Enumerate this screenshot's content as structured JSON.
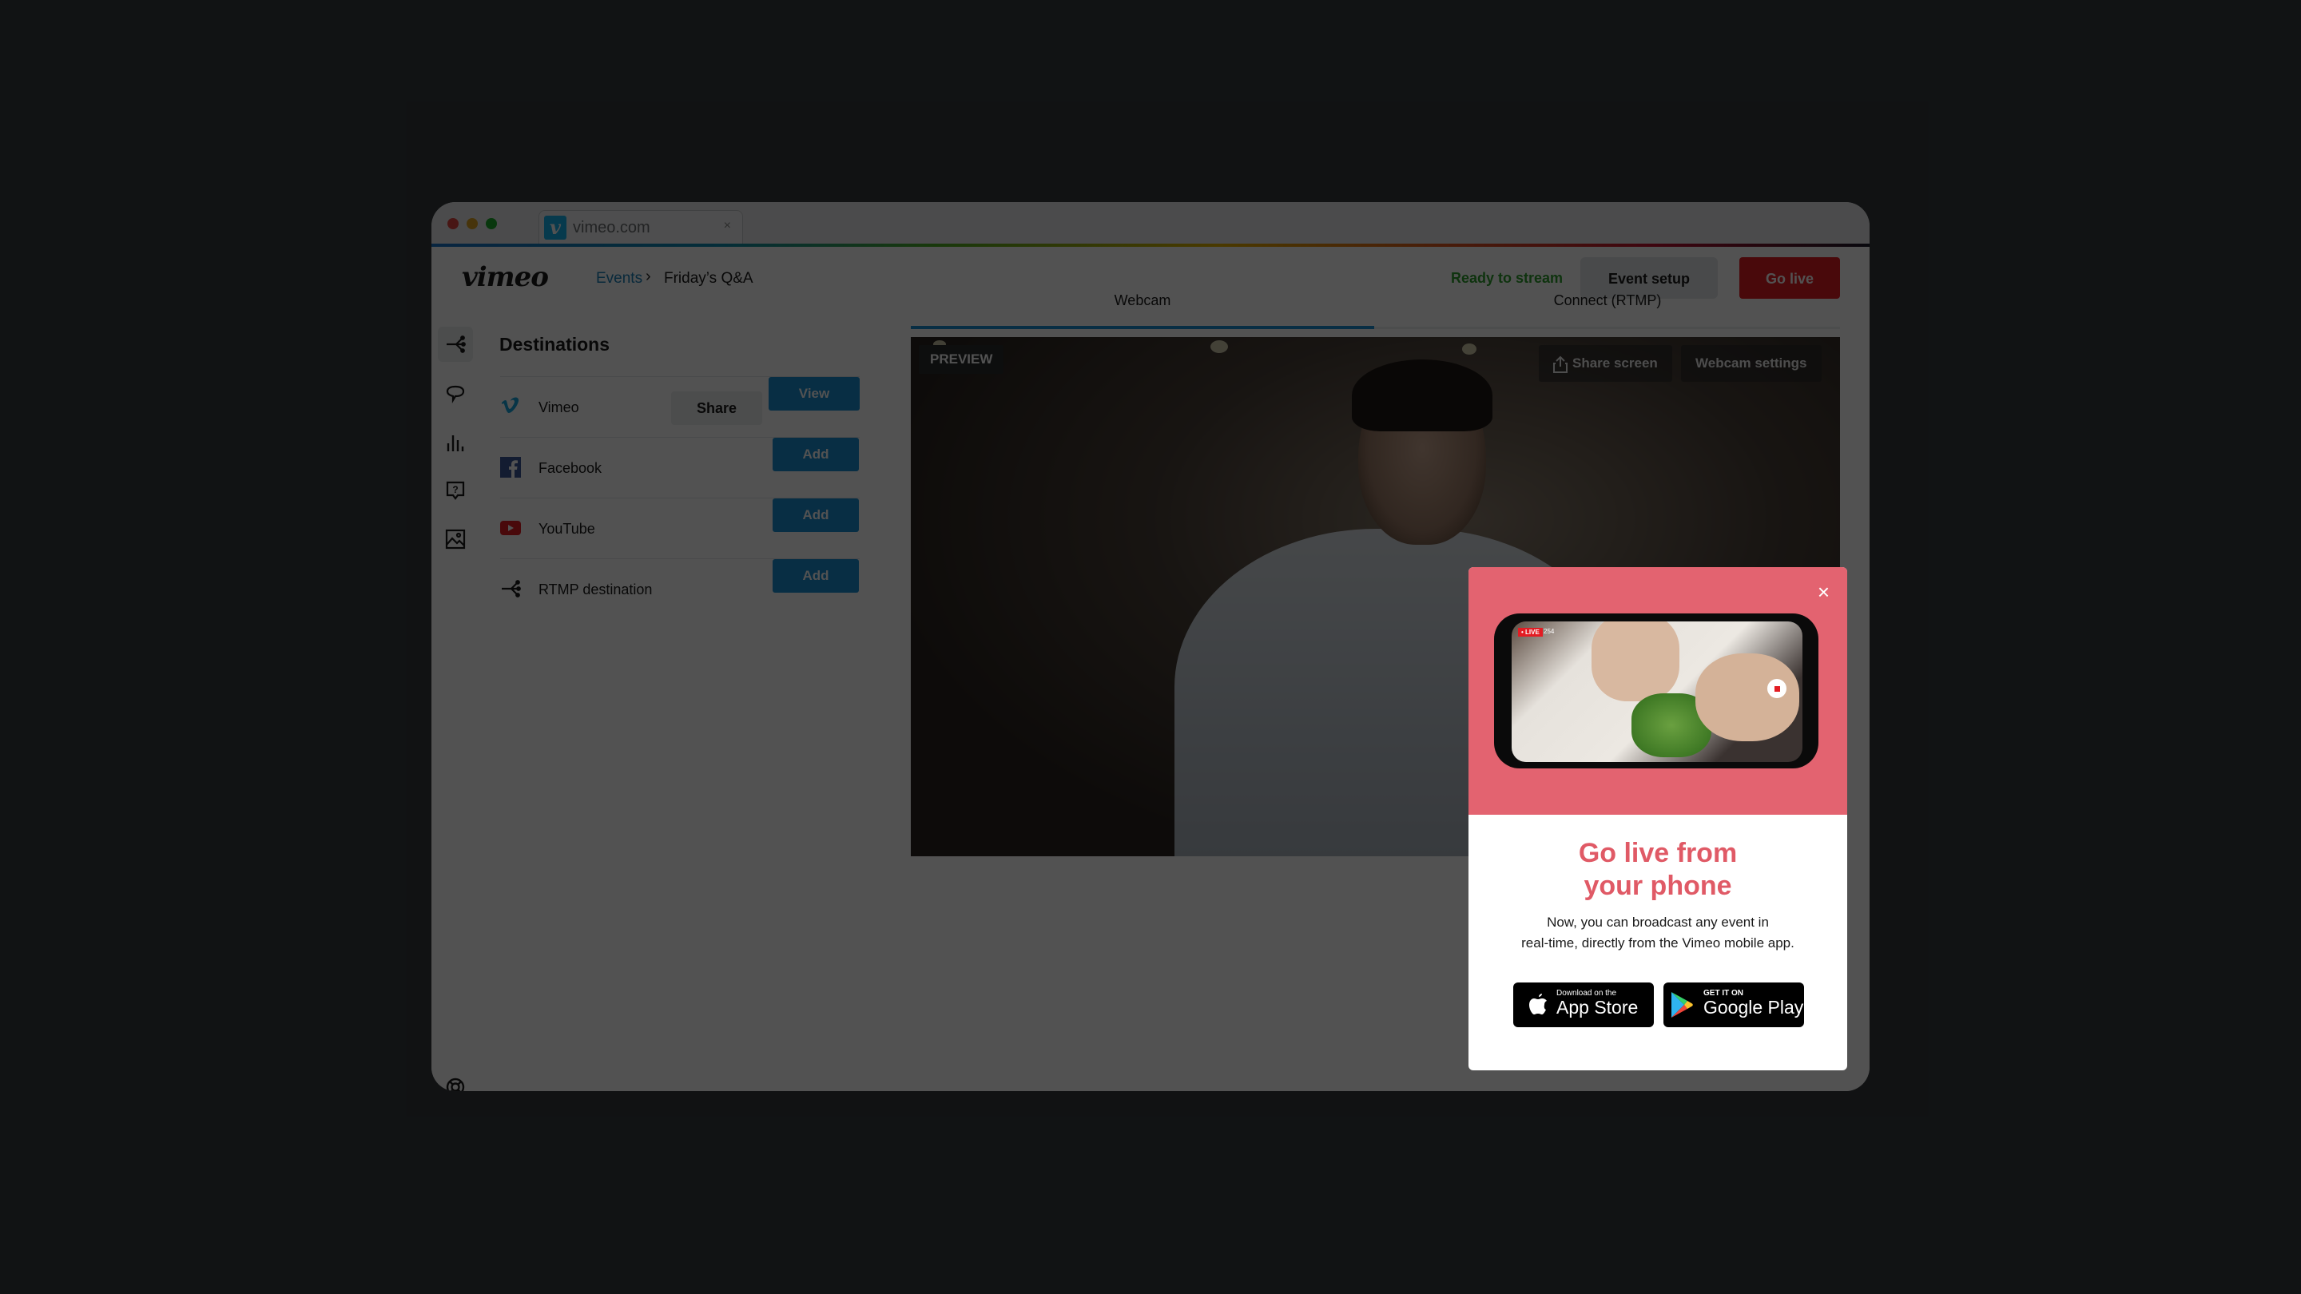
{
  "browser": {
    "tab_title": "vimeo.com",
    "tab_close": "×",
    "favicon": "v",
    "traffic_lights": [
      "#e0443e",
      "#dea123",
      "#1aab29"
    ]
  },
  "header": {
    "logo": "vimeo",
    "breadcrumb": {
      "parent": "Events",
      "separator": "›",
      "current": "Friday’s Q&A"
    },
    "status": "Ready to stream",
    "event_setup_label": "Event setup",
    "go_live_label": "Go live"
  },
  "sidebar": {
    "items": [
      {
        "icon": "destinations-icon",
        "active": true
      },
      {
        "icon": "chat-icon"
      },
      {
        "icon": "analytics-icon"
      },
      {
        "icon": "qa-icon"
      },
      {
        "icon": "graphics-icon"
      }
    ],
    "footer_icon": "help-icon"
  },
  "destinations": {
    "title": "Destinations",
    "items": [
      {
        "name": "Vimeo",
        "icon": "vimeo-icon",
        "secondary_label": "Share",
        "primary_label": "View"
      },
      {
        "name": "Facebook",
        "icon": "facebook-icon",
        "primary_label": "Add"
      },
      {
        "name": "YouTube",
        "icon": "youtube-icon",
        "primary_label": "Add"
      },
      {
        "name": "RTMP destination",
        "icon": "rtmp-icon",
        "primary_label": "Add"
      }
    ]
  },
  "source_tabs": [
    {
      "label": "Webcam",
      "active": true
    },
    {
      "label": "Connect (RTMP)",
      "active": false
    }
  ],
  "preview": {
    "badge": "PREVIEW",
    "share_screen_label": "Share screen",
    "webcam_settings_label": "Webcam settings"
  },
  "modal": {
    "close": "×",
    "phone_live_tag": "• LIVE",
    "phone_viewers": "254",
    "title_line1": "Go live from",
    "title_line2": "your phone",
    "desc_line1": "Now, you can broadcast any event in",
    "desc_line2": "real-time, directly from the Vimeo mobile app.",
    "app_store": {
      "small": "Download on the",
      "big": "App Store"
    },
    "google_play": {
      "small": "GET IT ON",
      "big": "Google Play"
    }
  },
  "colors": {
    "accent_blue": "#1a8fd4",
    "live_red": "#e31c23",
    "modal_pink": "#e36370",
    "ready_green": "#2e9e2e"
  }
}
